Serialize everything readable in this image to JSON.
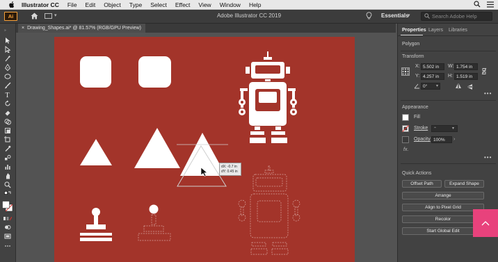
{
  "menubar": {
    "app_name": "Illustrator CC",
    "items": [
      "File",
      "Edit",
      "Object",
      "Type",
      "Select",
      "Effect",
      "View",
      "Window",
      "Help"
    ]
  },
  "appbar": {
    "logo": "Ai",
    "title": "Adobe Illustrator CC 2019",
    "workspace": "Essentials",
    "search_placeholder": "Search Adobe Help"
  },
  "document": {
    "tab_label": "Drawing_Shapes.ai* @ 81.57% (RGB/GPU Preview)"
  },
  "canvas": {
    "artboard_color": "#a3342a",
    "tooltip_dx": "dX: -0.7 in",
    "tooltip_dy": "dY: 0.45 in"
  },
  "panel": {
    "tabs": [
      "Properties",
      "Layers",
      "Libraries"
    ],
    "active_tab": "Properties",
    "selection_type": "Polygon",
    "transform": {
      "title": "Transform",
      "x_label": "X:",
      "x_value": "5.502 in",
      "y_label": "Y:",
      "y_value": "4.257 in",
      "w_label": "W:",
      "w_value": "1.754 in",
      "h_label": "H:",
      "h_value": "1.519 in",
      "angle_value": "0°"
    },
    "appearance": {
      "title": "Appearance",
      "fill_label": "Fill",
      "stroke_label": "Stroke",
      "opacity_label": "Opacity",
      "opacity_value": "100%",
      "fx_label": "fx."
    },
    "quick_actions": {
      "title": "Quick Actions",
      "offset_path": "Offset Path",
      "expand_shape": "Expand Shape",
      "arrange": "Arrange",
      "align_pixel": "Align to Pixel Grid",
      "recolor": "Recolor",
      "global_edit": "Start Global Edit"
    }
  },
  "colors": {
    "accent_pink": "#e8427c",
    "illustrator_orange": "#f7a13a"
  }
}
